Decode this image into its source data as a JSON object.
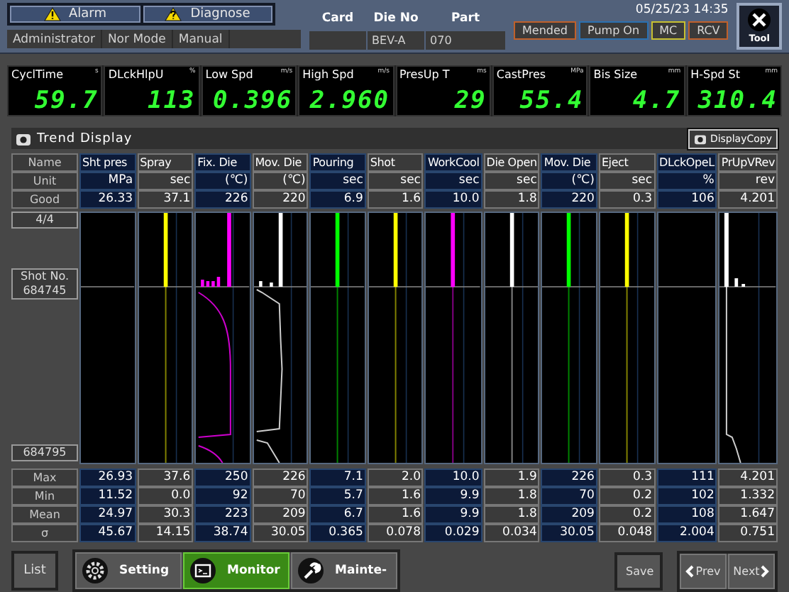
{
  "header": {
    "alarm_buttons": [
      {
        "label": "Alarm",
        "kind": "warning"
      },
      {
        "label": "Diagnose",
        "kind": "question"
      }
    ],
    "status": [
      "Administrator",
      "Nor Mode",
      "Manual"
    ],
    "job": [
      {
        "label": "Card"
      },
      {
        "label": "Die No",
        "value": "BEV-A"
      },
      {
        "label": "Part",
        "value": "070"
      }
    ],
    "datetime": "05/25/23 14:35",
    "indicators": [
      {
        "label": "Mended",
        "color": "#c0602a"
      },
      {
        "label": "Pump On",
        "color": "#2a70b0"
      },
      {
        "label": "MC",
        "color": "#c8c030"
      },
      {
        "label": "RCV",
        "color": "#c0602a"
      }
    ],
    "tool_button": "Tool"
  },
  "metrics": [
    {
      "label": "CyclTime",
      "unit": "s",
      "value": "59.7"
    },
    {
      "label": "DLckHlpU",
      "unit": "%",
      "value": "113"
    },
    {
      "label": "Low Spd",
      "unit": "m/s",
      "value": "0.396"
    },
    {
      "label": "High Spd",
      "unit": "m/s",
      "value": "2.960"
    },
    {
      "label": "PresUp T",
      "unit": "ms",
      "value": "29"
    },
    {
      "label": "CastPres",
      "unit": "MPa",
      "value": "55.4"
    },
    {
      "label": "Bis Size",
      "unit": "mm",
      "value": "4.7"
    },
    {
      "label": "H-Spd St",
      "unit": "mm",
      "value": "310.4"
    }
  ],
  "trend": {
    "title": "Trend Display",
    "copy_button": "DisplayCopy",
    "row_labels": [
      "Name",
      "Unit",
      "Good"
    ],
    "page": "4/4",
    "shot_label": "Shot No.",
    "shot_first": "684745",
    "shot_last": "684795",
    "stat_labels": [
      "Max",
      "Min",
      "Mean",
      "σ"
    ],
    "columns": [
      {
        "name": "Sht pres",
        "unit": "MPa",
        "good": "26.33",
        "highlighted": true,
        "kind": "empty",
        "stats": [
          "26.93",
          "11.52",
          "24.97",
          "45.67"
        ]
      },
      {
        "name": "Spray",
        "unit": "sec",
        "good": "37.1",
        "highlighted": false,
        "kind": "steady",
        "color": "#ffff00",
        "stats": [
          "37.6",
          "0.0",
          "30.3",
          "14.15"
        ]
      },
      {
        "name": "Fix. Die",
        "unit": "(℃)",
        "good": "226",
        "highlighted": true,
        "kind": "curved",
        "color": "#ff00ff",
        "stats": [
          "250",
          "92",
          "223",
          "38.74"
        ]
      },
      {
        "name": "Mov. Die",
        "unit": "(℃)",
        "good": "220",
        "highlighted": false,
        "kind": "jagged",
        "color": "#ffffff",
        "stats": [
          "226",
          "70",
          "209",
          "30.05"
        ]
      },
      {
        "name": "Pouring",
        "unit": "sec",
        "good": "6.9",
        "highlighted": true,
        "kind": "steady",
        "color": "#00ff00",
        "stats": [
          "7.1",
          "5.7",
          "6.7",
          "0.365"
        ]
      },
      {
        "name": "Shot",
        "unit": "sec",
        "good": "1.6",
        "highlighted": false,
        "kind": "steady",
        "color": "#ffff00",
        "stats": [
          "2.0",
          "1.6",
          "1.6",
          "0.078"
        ]
      },
      {
        "name": "WorkCool",
        "unit": "sec",
        "good": "10.0",
        "highlighted": true,
        "kind": "steady",
        "color": "#ff00ff",
        "stats": [
          "10.0",
          "9.9",
          "9.9",
          "0.029"
        ]
      },
      {
        "name": "Die Open",
        "unit": "sec",
        "good": "1.8",
        "highlighted": false,
        "kind": "steady",
        "color": "#ffffff",
        "stats": [
          "1.9",
          "1.8",
          "1.8",
          "0.034"
        ]
      },
      {
        "name": "Mov. Die",
        "unit": "(℃)",
        "good": "220",
        "highlighted": true,
        "kind": "steady",
        "color": "#00ff00",
        "stats": [
          "226",
          "70",
          "209",
          "30.05"
        ]
      },
      {
        "name": "Eject",
        "unit": "sec",
        "good": "0.3",
        "highlighted": false,
        "kind": "steady",
        "color": "#ffff00",
        "stats": [
          "0.3",
          "0.2",
          "0.2",
          "0.048"
        ]
      },
      {
        "name": "DLckOpeL",
        "unit": "%",
        "good": "106",
        "highlighted": true,
        "kind": "empty",
        "stats": [
          "111",
          "102",
          "108",
          "2.004"
        ]
      },
      {
        "name": "PrUpVRev",
        "unit": "rev",
        "good": "4.201",
        "highlighted": false,
        "kind": "tail",
        "color": "#ffffff",
        "stats": [
          "4.201",
          "1.332",
          "1.647",
          "0.751"
        ]
      }
    ]
  },
  "footer": {
    "list_button": "List",
    "tabs": [
      {
        "label": "Setting",
        "kind": "setting",
        "selected": false
      },
      {
        "label": "Monitor",
        "kind": "monitor",
        "selected": true
      },
      {
        "label": "Mainte-",
        "kind": "maintenance",
        "selected": false
      }
    ],
    "save_button": "Save",
    "prev_button": "Prev",
    "next_button": "Next"
  }
}
